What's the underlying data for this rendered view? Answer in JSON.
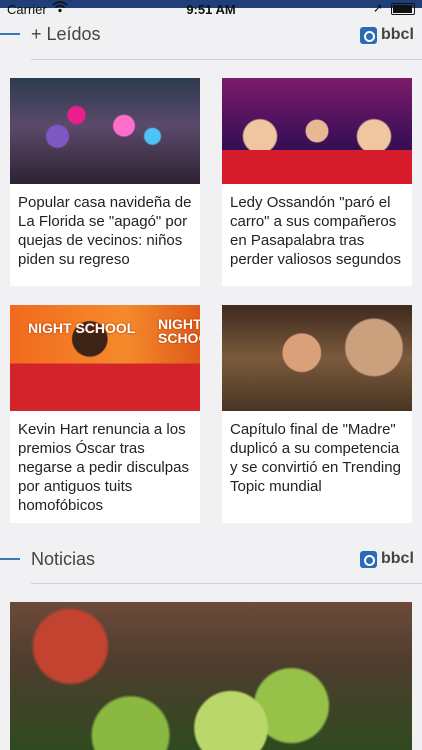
{
  "status_bar": {
    "carrier": "Carrier",
    "wifi_icon": "wifi-icon",
    "time": "9:51 AM",
    "location_icon": "location-arrow-icon",
    "battery_icon": "battery-icon"
  },
  "sections": {
    "leidos": {
      "title": "+ Leídos",
      "brand": "bbcl"
    },
    "noticias": {
      "title": "Noticias",
      "brand": "bbcl"
    }
  },
  "cards": [
    {
      "headline": "Popular casa navideña de La Florida se \"apagó\" por quejas de vecinos: niños piden su regreso"
    },
    {
      "headline": "Ledy Ossandón \"paró el carro\" a sus compañeros en Pasapalabra tras perder valiosos segundos"
    },
    {
      "headline": "Kevin Hart renuncia a los premios Óscar tras negarse a pedir disculpas por antiguos tuits homofóbicos",
      "image_text": "NIGHT SCHOOL"
    },
    {
      "headline": "Capítulo final de \"Madre\" duplicó a su competencia y se convirtió en Trending Topic mundial"
    }
  ],
  "colors": {
    "accent": "#3a78b8",
    "brand": "#2a6bb7",
    "header_bar": "#1e3f7a",
    "background": "#f1f1f3"
  }
}
